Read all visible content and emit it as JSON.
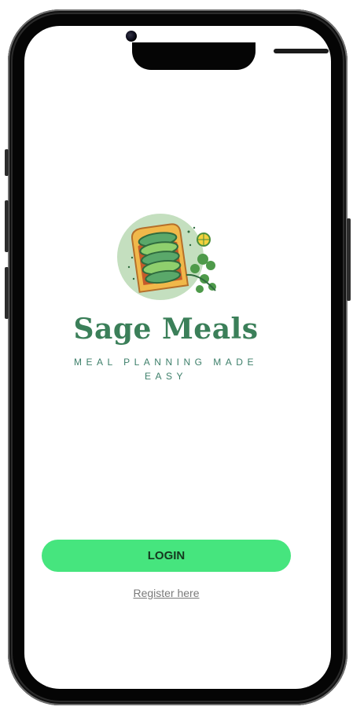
{
  "app": {
    "brand_name": "Sage Meals",
    "tagline": "MEAL PLANNING MADE EASY"
  },
  "actions": {
    "login_label": "LOGIN",
    "register_label": "Register here"
  },
  "colors": {
    "primary_button": "#46e57e",
    "brand_green": "#3b7f59",
    "logo_circle": "#c4dfbf",
    "link_gray": "#7a7a7a"
  },
  "icons": {
    "logo": "avocado-toast-logo-icon"
  }
}
